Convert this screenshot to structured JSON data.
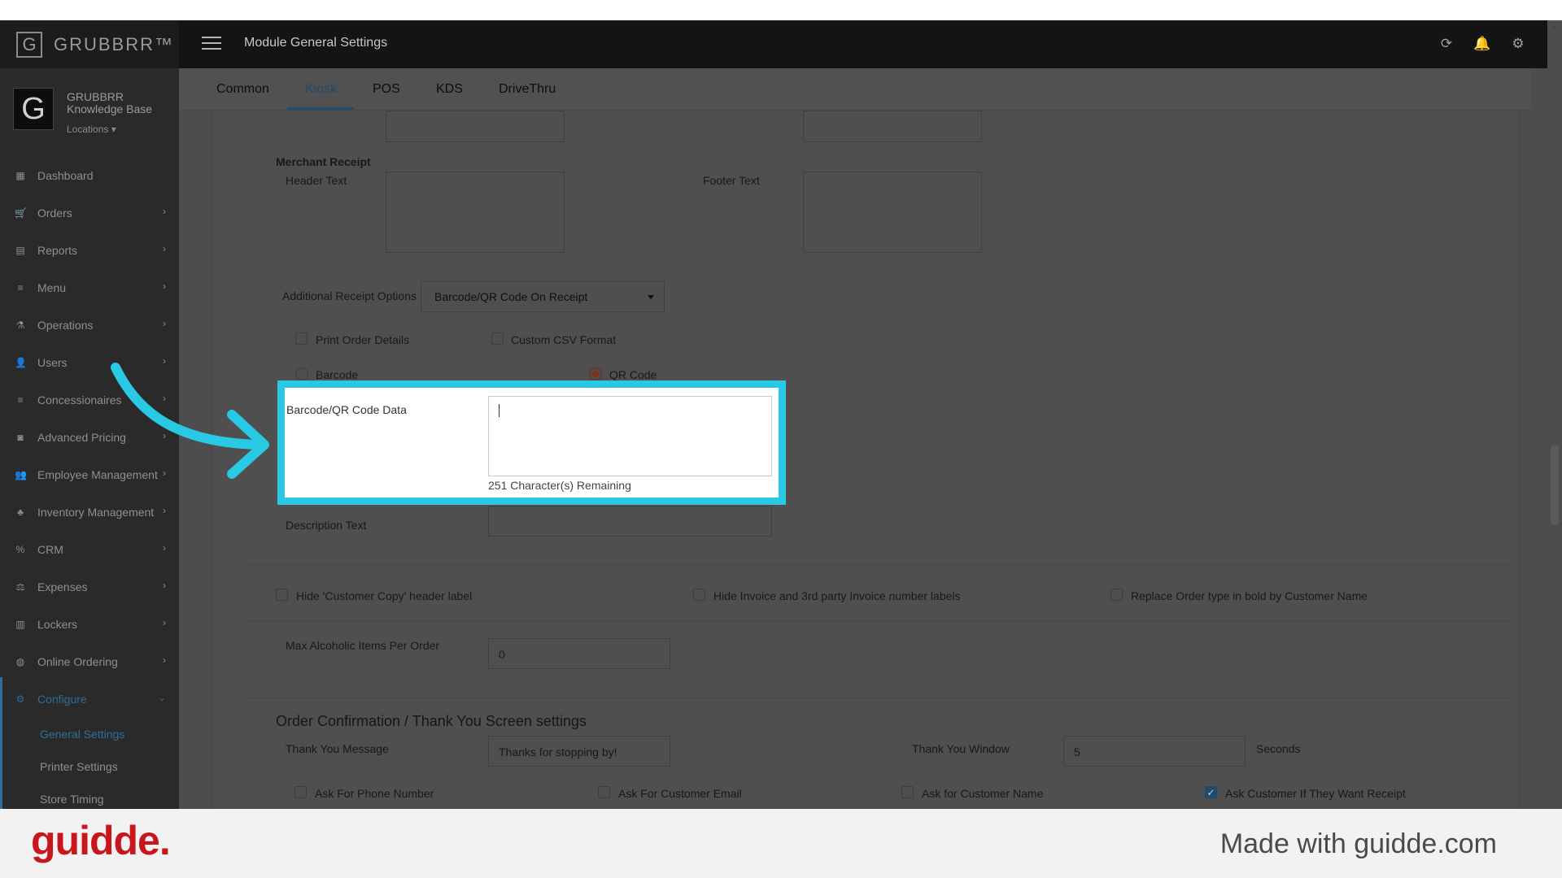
{
  "app": {
    "brand": "GRUBBRR™",
    "page_title": "Module General Settings"
  },
  "profile": {
    "name": "GRUBBRR Knowledge Base",
    "locations": "Locations ▾"
  },
  "sidebar": {
    "items": [
      {
        "label": "Dashboard",
        "icon": "dashboard-icon",
        "glyph": "▦",
        "chevron": false
      },
      {
        "label": "Orders",
        "icon": "cart-icon",
        "glyph": "🛒",
        "chevron": true
      },
      {
        "label": "Reports",
        "icon": "report-icon",
        "glyph": "▤",
        "chevron": true
      },
      {
        "label": "Menu",
        "icon": "list-icon",
        "glyph": "≡",
        "chevron": true
      },
      {
        "label": "Operations",
        "icon": "flask-icon",
        "glyph": "⚗",
        "chevron": true
      },
      {
        "label": "Users",
        "icon": "user-add-icon",
        "glyph": "👤",
        "chevron": true
      },
      {
        "label": "Concessionaires",
        "icon": "list-icon",
        "glyph": "≡",
        "chevron": true
      },
      {
        "label": "Advanced Pricing",
        "icon": "money-icon",
        "glyph": "◙",
        "chevron": true
      },
      {
        "label": "Employee Management",
        "icon": "users-icon",
        "glyph": "👥",
        "chevron": true
      },
      {
        "label": "Inventory Management",
        "icon": "sitemap-icon",
        "glyph": "♣",
        "chevron": true
      },
      {
        "label": "CRM",
        "icon": "percent-icon",
        "glyph": "%",
        "chevron": true
      },
      {
        "label": "Expenses",
        "icon": "scale-icon",
        "glyph": "⚖",
        "chevron": true
      },
      {
        "label": "Lockers",
        "icon": "locker-icon",
        "glyph": "▥",
        "chevron": true
      },
      {
        "label": "Online Ordering",
        "icon": "globe-icon",
        "glyph": "◍",
        "chevron": true
      },
      {
        "label": "Configure",
        "icon": "gear-icon",
        "glyph": "⚙",
        "chevron": true,
        "active": true
      }
    ],
    "sub_items": [
      "General Settings",
      "Printer Settings",
      "Store Timing"
    ]
  },
  "tabs": [
    "Common",
    "Kiosk",
    "POS",
    "KDS",
    "DriveThru"
  ],
  "form": {
    "merchant_receipt": "Merchant Receipt",
    "header_text": "Header Text",
    "footer_text": "Footer Text",
    "additional_receipt_options_label": "Additional Receipt Options",
    "additional_receipt_options_value": "Barcode/QR Code On Receipt",
    "print_order_details": "Print Order Details",
    "custom_csv_format": "Custom CSV Format",
    "barcode": "Barcode",
    "qr_code": "QR Code",
    "barcode_qr_data_label": "Barcode/QR Code Data",
    "remaining": "251 Character(s) Remaining",
    "description_text": "Description Text",
    "hide_customer_copy": "Hide 'Customer Copy' header label",
    "hide_invoice": "Hide Invoice and 3rd party Invoice number labels",
    "replace_order_type": "Replace Order type in bold by Customer Name",
    "max_alcoholic_label": "Max Alcoholic Items Per Order",
    "max_alcoholic_value": "0",
    "order_confirmation_title": "Order Confirmation / Thank You Screen settings",
    "thank_you_message_label": "Thank You Message",
    "thank_you_message_value": "Thanks for stopping by!",
    "thank_you_window_label": "Thank You Window",
    "thank_you_window_value": "5",
    "seconds": "Seconds",
    "ask_phone": "Ask For Phone Number",
    "ask_email": "Ask For Customer Email",
    "ask_name": "Ask for Customer Name",
    "ask_receipt": "Ask Customer If They Want Receipt"
  },
  "footer": {
    "logo": "guidde.",
    "made_with": "Made with guidde.com"
  },
  "colors": {
    "highlight": "#29c8e5",
    "accent": "#2f6e9c",
    "brand_red": "#c8161d"
  }
}
